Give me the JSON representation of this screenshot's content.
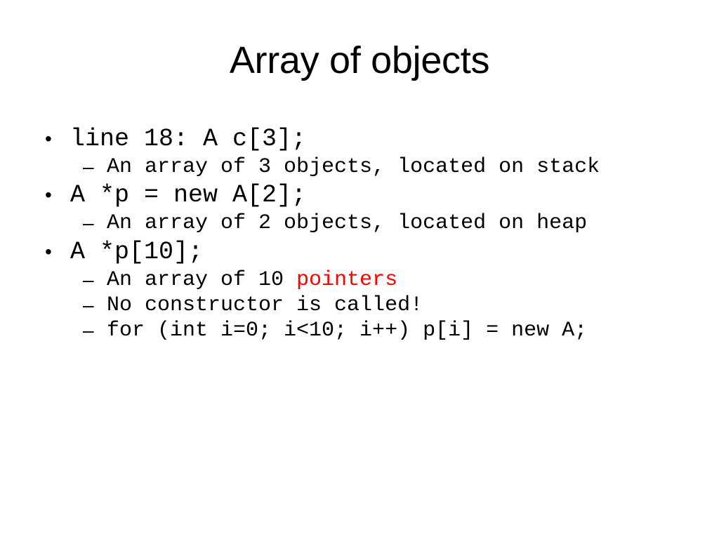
{
  "slide": {
    "title": "Array of objects",
    "background_color": "#FFFFFF",
    "text_color": "#000000",
    "accent_color": "#FF0000",
    "bullet_marker": "•",
    "sub_bullet_marker": "–",
    "bullets": [
      {
        "text": "line 18: A c[3];",
        "sub": [
          {
            "text": "An array of 3 objects, located on stack"
          }
        ]
      },
      {
        "text": "A *p = new A[2];",
        "sub": [
          {
            "text": "An array of 2 objects, located on heap"
          }
        ]
      },
      {
        "text": "A *p[10];",
        "sub": [
          {
            "text_plain": "An array of 10 ",
            "text_accent": "pointers"
          },
          {
            "text": "No constructor is called!"
          },
          {
            "text": "for (int i=0; i<10; i++) p[i] = new A;"
          }
        ]
      }
    ]
  }
}
